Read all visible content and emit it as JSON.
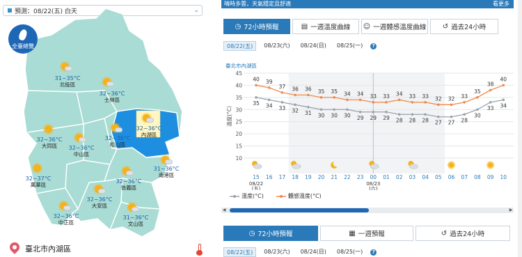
{
  "map": {
    "forecast_label": "預測：08/22(五) 白天",
    "overview_label": "全臺總覽",
    "location": "臺北市內湖區",
    "districts": [
      {
        "name": "北投區",
        "temp": "31~35°C",
        "highlight": false
      },
      {
        "name": "士林區",
        "temp": "32~36°C",
        "highlight": false
      },
      {
        "name": "內湖區",
        "temp": "32~36°C",
        "highlight": true
      },
      {
        "name": "大同區",
        "temp": "32~36°C",
        "highlight": false
      },
      {
        "name": "中山區",
        "temp": "32~36°C",
        "highlight": false
      },
      {
        "name": "松山區",
        "temp": "32~36°C",
        "highlight": false
      },
      {
        "name": "南港區",
        "temp": "31~36°C",
        "highlight": false
      },
      {
        "name": "萬華區",
        "temp": "32~37°C",
        "highlight": false
      },
      {
        "name": "信義區",
        "temp": "32~36°C",
        "highlight": false
      },
      {
        "name": "大安區",
        "temp": "32~36°C",
        "highlight": false
      },
      {
        "name": "中正區",
        "temp": "32~36°C",
        "highlight": false
      },
      {
        "name": "文山區",
        "temp": "31~36°C",
        "highlight": false
      }
    ]
  },
  "header": {
    "strip_text": "晴時多雲，天氣穩定且舒適",
    "more_label": "看更多"
  },
  "tabs_top": [
    {
      "label": "72小時預報",
      "icon": "clock-icon",
      "active": true
    },
    {
      "label": "一週溫度曲線",
      "icon": "chart-icon",
      "active": false
    },
    {
      "label": "一週體感溫度曲線",
      "icon": "person-icon",
      "active": false
    },
    {
      "label": "過去24小時",
      "icon": "history-icon",
      "active": false
    }
  ],
  "dates_top": [
    {
      "label": "08/22(五)",
      "active": true
    },
    {
      "label": "08/23(六)",
      "active": false
    },
    {
      "label": "08/24(日)",
      "active": false
    },
    {
      "label": "08/25(一)",
      "active": false
    }
  ],
  "chart_title": "臺北市內湖區",
  "chart_data": {
    "type": "line",
    "ylabel": "溫度(°C)",
    "ylim": [
      10,
      45
    ],
    "yticks": [
      10,
      15,
      20,
      25,
      30,
      35,
      40,
      45
    ],
    "x": [
      "15",
      "16",
      "17",
      "18",
      "19",
      "20",
      "21",
      "22",
      "23",
      "00",
      "01",
      "02",
      "03",
      "04",
      "05",
      "06",
      "07",
      "08",
      "09",
      "10"
    ],
    "date_marks": [
      {
        "at": "15",
        "label": "08/22",
        "sub": "(五)"
      },
      {
        "at": "00",
        "label": "08/23",
        "sub": "(六)"
      }
    ],
    "series": [
      {
        "name": "溫度(°C)",
        "color": "#9aa3ad",
        "values": [
          35,
          34,
          33,
          32,
          31,
          30,
          30,
          30,
          29,
          29,
          29,
          28,
          28,
          28,
          27,
          27,
          28,
          30,
          33,
          34
        ]
      },
      {
        "name": "體感溫度(°C)",
        "color": "#f08a4b",
        "values": [
          40,
          39,
          37,
          36,
          36,
          35,
          35,
          34,
          34,
          33,
          33,
          34,
          33,
          33,
          32,
          32,
          33,
          35,
          38,
          40
        ]
      }
    ],
    "weather_icons": [
      "partly-cloudy-icon",
      "cloudy-icon",
      "moon-icon",
      "partly-cloudy-icon",
      "partly-cloudy-icon",
      "sun-icon",
      "sun-icon"
    ],
    "grid": true
  },
  "tabs_bottom": [
    {
      "label": "72小時預報",
      "active": true
    },
    {
      "label": "一週預報",
      "active": false
    },
    {
      "label": "過去24小時",
      "active": false
    }
  ],
  "dates_bottom": [
    {
      "label": "08/22(五)",
      "active": true
    },
    {
      "label": "08/23(六)",
      "active": false
    },
    {
      "label": "08/24(日)",
      "active": false
    },
    {
      "label": "08/25(一)",
      "active": false
    }
  ],
  "help_label": "?",
  "colors": {
    "accent": "#2a79b8",
    "map_fill": "#a9dcd4",
    "map_highlight": "#1e8fe0",
    "temp_line": "#9aa3ad",
    "feel_line": "#f08a4b"
  }
}
